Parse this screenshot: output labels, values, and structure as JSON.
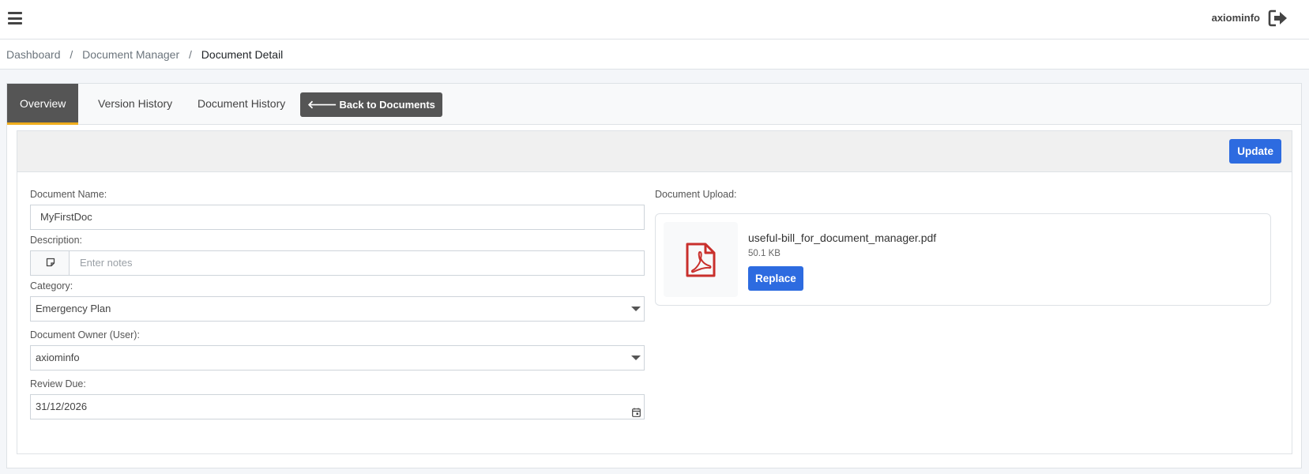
{
  "topbar": {
    "menu_icon": "hamburger-icon",
    "username": "axiominfo",
    "logout_icon": "sign-out-icon"
  },
  "breadcrumb": {
    "items": [
      "Dashboard",
      "Document Manager"
    ],
    "separator": "/",
    "current": "Document Detail"
  },
  "tabs": [
    {
      "label": "Overview",
      "active": true
    },
    {
      "label": "Version History",
      "active": false
    },
    {
      "label": "Document History",
      "active": false
    }
  ],
  "back_button": {
    "icon": "arrow-left-icon",
    "label": "Back to Documents"
  },
  "update_button": {
    "label": "Update"
  },
  "form": {
    "name": {
      "label": "Document Name:",
      "value": "MyFirstDoc"
    },
    "description": {
      "label": "Description:",
      "icon": "note-icon",
      "placeholder": "Enter notes"
    },
    "category": {
      "label": "Category:",
      "value": "Emergency Plan"
    },
    "owner": {
      "label": "Document Owner (User):",
      "value": "axiominfo"
    },
    "review_due": {
      "label": "Review Due:",
      "value": "31/12/2026",
      "icon": "calendar-icon"
    }
  },
  "upload": {
    "label": "Document Upload:",
    "file_icon": "pdf-file-icon",
    "file_name": "useful-bill_for_document_manager.pdf",
    "file_size": "50.1 KB",
    "replace_label": "Replace"
  },
  "colors": {
    "primary": "#2d6be0",
    "dark_button": "#555555",
    "tab_accent": "#f0ad1c",
    "pdf_red": "#c9302c"
  }
}
